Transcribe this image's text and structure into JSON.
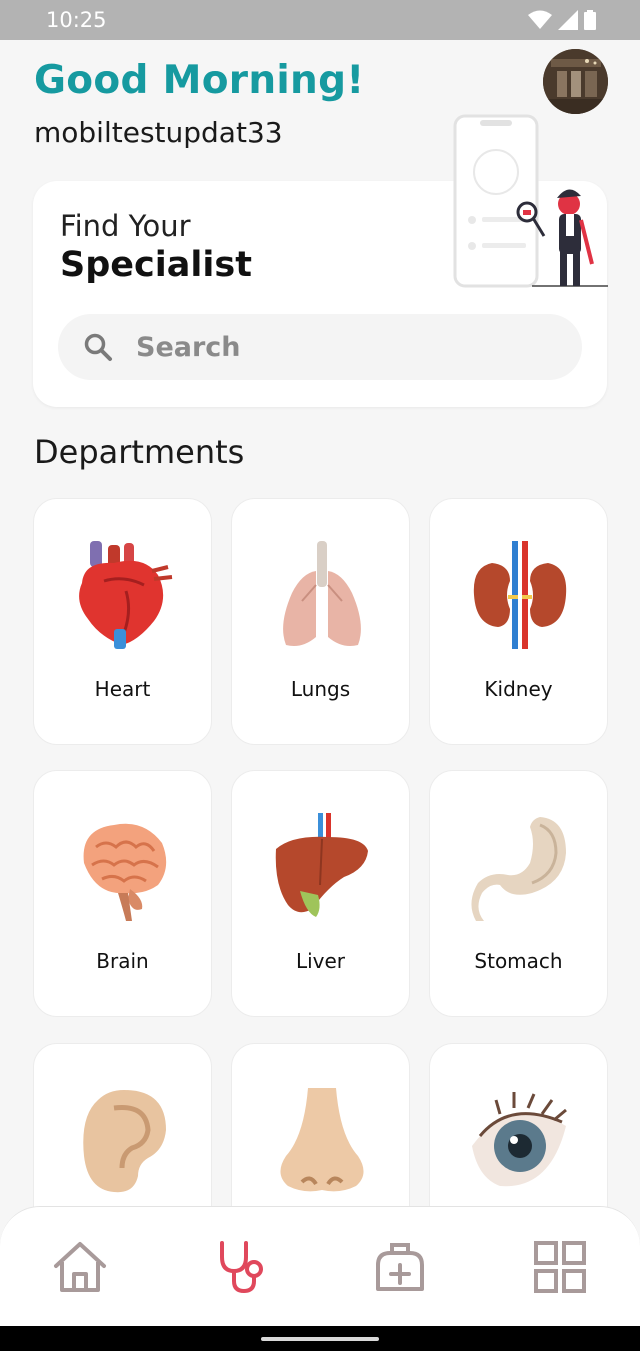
{
  "status_bar": {
    "time": "10:25",
    "icons": [
      "wifi-icon",
      "signal-icon",
      "battery-icon"
    ]
  },
  "header": {
    "greeting": "Good Morning!",
    "username": "mobiltestupdat33"
  },
  "finder": {
    "line1": "Find Your",
    "line2": "Specialist",
    "search_placeholder": "Search"
  },
  "departments": {
    "title": "Departments",
    "items": [
      {
        "label": "Heart",
        "icon": "heart-icon"
      },
      {
        "label": "Lungs",
        "icon": "lungs-icon"
      },
      {
        "label": "Kidney",
        "icon": "kidney-icon"
      },
      {
        "label": "Brain",
        "icon": "brain-icon"
      },
      {
        "label": "Liver",
        "icon": "liver-icon"
      },
      {
        "label": "Stomach",
        "icon": "stomach-icon"
      },
      {
        "label": "",
        "icon": "ear-icon"
      },
      {
        "label": "",
        "icon": "nose-icon"
      },
      {
        "label": "",
        "icon": "eye-icon"
      }
    ]
  },
  "nav": {
    "items": [
      "home-icon",
      "stethoscope-icon",
      "medical-kit-icon",
      "grid-icon"
    ],
    "active": "stethoscope-icon"
  },
  "colors": {
    "accent": "#169aa0",
    "nav_active": "#e0485c",
    "nav_inactive": "#a89a9a"
  }
}
